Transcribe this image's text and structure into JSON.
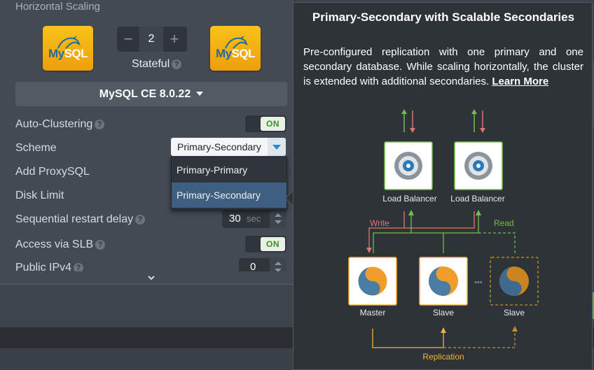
{
  "section": {
    "title": "Horizontal Scaling"
  },
  "logos": {
    "left_text_1": "My",
    "left_text_2": "SQL",
    "right_text_1": "My",
    "right_text_2": "SQL"
  },
  "stepper": {
    "minus": "−",
    "value": "2",
    "plus": "+"
  },
  "stateful": {
    "label": "Stateful",
    "help": "?"
  },
  "version": {
    "label": "MySQL CE 8.0.22"
  },
  "rows": {
    "auto_clustering": {
      "label": "Auto-Clustering",
      "help": "?",
      "toggle": "ON"
    },
    "scheme": {
      "label": "Scheme",
      "value": "Primary-Secondary"
    },
    "add_proxysql": {
      "label": "Add ProxySQL"
    },
    "disk_limit": {
      "label": "Disk Limit"
    },
    "seq_restart": {
      "label": "Sequential restart delay",
      "help": "?",
      "value": "30",
      "unit": "sec"
    },
    "access_slb": {
      "label": "Access via SLB",
      "help": "?",
      "toggle": "ON"
    },
    "public_ipv4": {
      "label": "Public IPv4",
      "help": "?",
      "value": "0"
    }
  },
  "dropdown": {
    "options": [
      "Primary-Primary",
      "Primary-Secondary"
    ],
    "selected": "Primary-Secondary"
  },
  "tooltip": {
    "title": "Primary-Secondary with Scalable Secondaries",
    "description": "Pre-configured replication with one primary and one secondary database. While scaling horizontally, the cluster is extended with additional secondaries. ",
    "link": "Learn More"
  },
  "diagram": {
    "lb1": "Load Balancer",
    "lb2": "Load Balancer",
    "write": "Write",
    "read": "Read",
    "master": "Master",
    "slave1": "Slave",
    "slave2": "Slave",
    "dots": "•••",
    "replication": "Replication"
  },
  "colors": {
    "accent_orange": "#f4b13a",
    "write_red": "#e0736f",
    "read_green": "#6fbf4a",
    "toggle_on": "#3a8f2c",
    "selected_blue": "#3e5f80"
  }
}
